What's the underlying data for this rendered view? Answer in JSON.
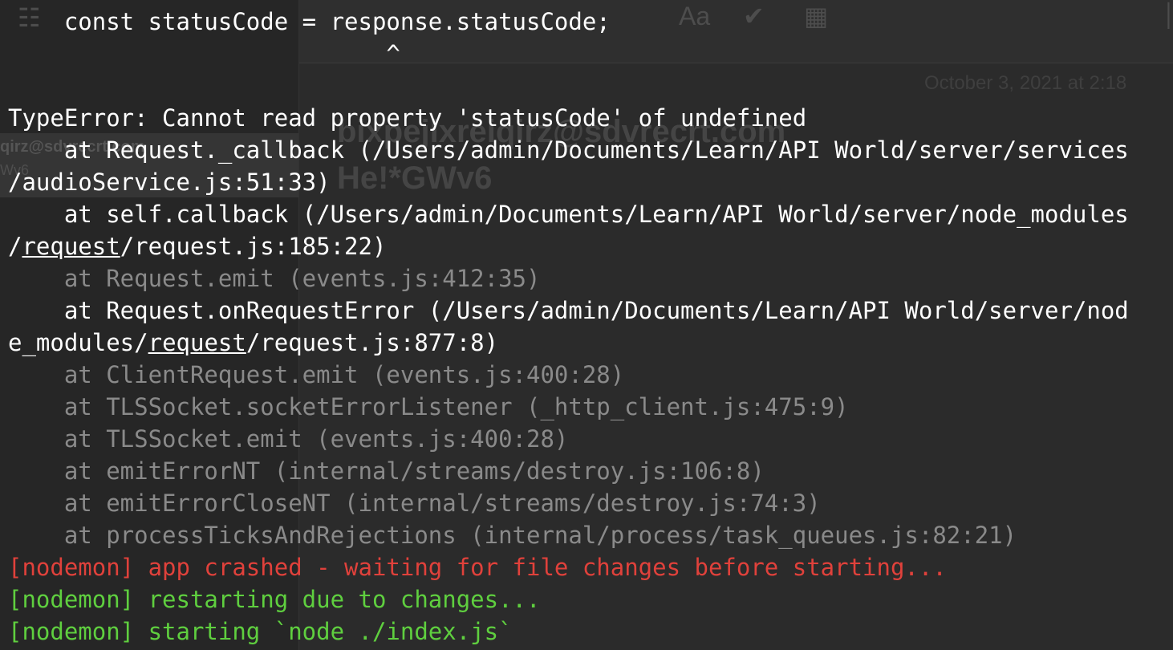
{
  "background_window": {
    "date": "October 3, 2021 at 2:18",
    "sender": "bixpejlxreiqirz@sdvrecrt.com",
    "subject": "He!*GWv6",
    "list_sender": "qirz@sdvrecrt.com",
    "list_subject": "Wv6",
    "icons": [
      "grid-icon",
      "font-size-icon",
      "checkmark-circle-icon",
      "table-icon"
    ]
  },
  "terminal": {
    "line_code": "    const statusCode = response.statusCode;",
    "line_caret": "                           ^",
    "line_blank": "",
    "error_message": "TypeError: Cannot read property 'statusCode' of undefined",
    "trace1_a": "    at Request._callback (/Users/admin/Documents/Learn/API World/server/services",
    "trace1_b": "/audioService.js:51:33)",
    "trace2_a": "    at self.callback (/Users/admin/Documents/Learn/API World/server/node_modules",
    "trace2_b_pre": "/",
    "trace2_b_link": "request",
    "trace2_b_post": "/request.js:185:22)",
    "trace3": "    at Request.emit (events.js:412:35)",
    "trace4_a": "    at Request.onRequestError (/Users/admin/Documents/Learn/API World/server/nod",
    "trace4_b_pre": "e_modules/",
    "trace4_b_link": "request",
    "trace4_b_post": "/request.js:877:8)",
    "trace5": "    at ClientRequest.emit (events.js:400:28)",
    "trace6": "    at TLSSocket.socketErrorListener (_http_client.js:475:9)",
    "trace7": "    at TLSSocket.emit (events.js:400:28)",
    "trace8": "    at emitErrorNT (internal/streams/destroy.js:106:8)",
    "trace9": "    at emitErrorCloseNT (internal/streams/destroy.js:74:3)",
    "trace10": "    at processTicksAndRejections (internal/process/task_queues.js:82:21)",
    "nodemon_crash": "[nodemon] app crashed - waiting for file changes before starting...",
    "nodemon_restart": "[nodemon] restarting due to changes...",
    "nodemon_start": "[nodemon] starting `node ./index.js`"
  },
  "colors": {
    "background": "#2b2b2b",
    "text": "#ffffff",
    "dim": "#8a8a8a",
    "error": "#e0413b",
    "success": "#5fcf3f"
  }
}
